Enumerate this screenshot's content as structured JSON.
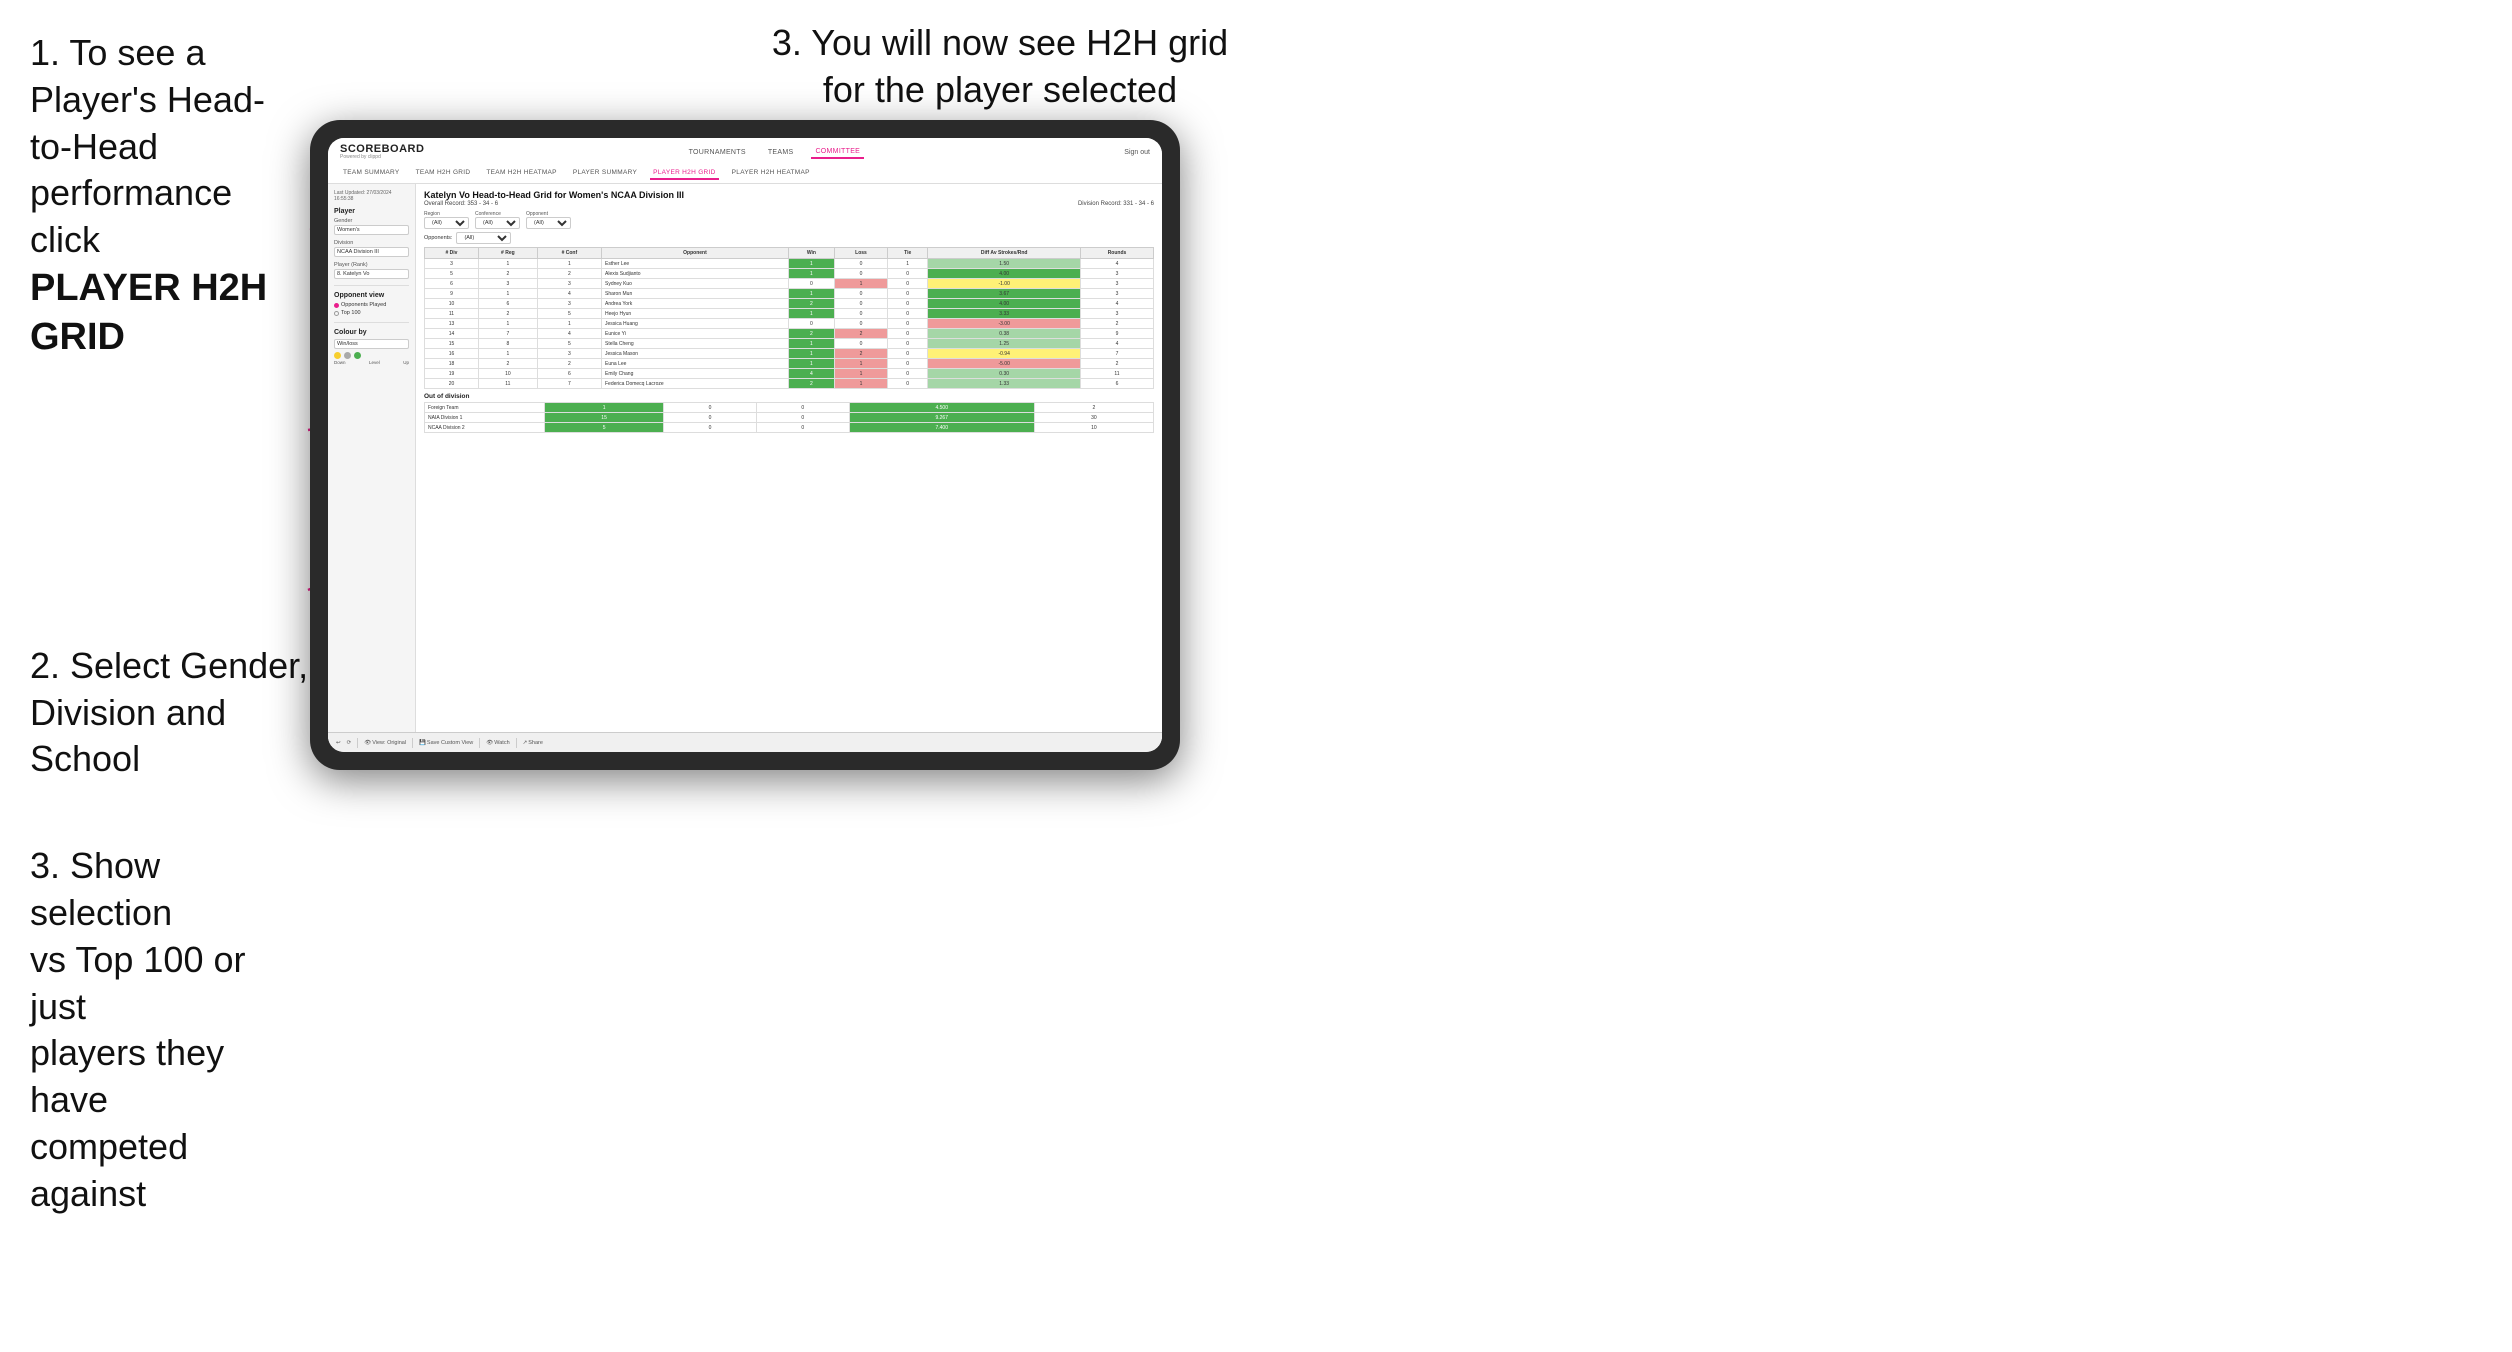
{
  "instructions": {
    "step1_line1": "1. To see a Player's Head-",
    "step1_line2": "to-Head performance click",
    "step1_bold": "PLAYER H2H GRID",
    "step2_line1": "2. Select Gender,",
    "step2_line2": "Division and",
    "step2_line3": "School",
    "step3a_line1": "3. Show selection",
    "step3a_line2": "vs Top 100 or just",
    "step3a_line3": "players they have",
    "step3a_line4": "competed against",
    "step3b_line1": "3. You will now see H2H grid",
    "step3b_line2": "for the player selected"
  },
  "navbar": {
    "logo_main": "SCOREBOARD",
    "logo_sub": "Powered by clippd",
    "nav_tournaments": "TOURNAMENTS",
    "nav_teams": "TEAMS",
    "nav_committee": "COMMITTEE",
    "sign_out": "Sign out",
    "sub_team_summary": "TEAM SUMMARY",
    "sub_team_h2h": "TEAM H2H GRID",
    "sub_team_heatmap": "TEAM H2H HEATMAP",
    "sub_player_summary": "PLAYER SUMMARY",
    "sub_player_h2h": "PLAYER H2H GRID",
    "sub_player_heatmap": "PLAYER H2H HEATMAP"
  },
  "left_panel": {
    "timestamp": "Last Updated: 27/03/2024",
    "timestamp2": "16:55:38",
    "player_label": "Player",
    "gender_label": "Gender",
    "gender_value": "Women's",
    "division_label": "Division",
    "division_value": "NCAA Division III",
    "player_rank_label": "Player (Rank)",
    "player_rank_value": "8. Katelyn Vo",
    "opponent_view_label": "Opponent view",
    "radio_opponents": "Opponents Played",
    "radio_top100": "Top 100",
    "colour_by_label": "Colour by",
    "colour_by_value": "Win/loss",
    "legend_down": "Down",
    "legend_level": "Level",
    "legend_up": "Up"
  },
  "grid": {
    "title": "Katelyn Vo Head-to-Head Grid for Women's NCAA Division III",
    "overall_record": "Overall Record: 353 - 34 - 6",
    "division_record": "Division Record: 331 - 34 - 6",
    "region_label": "Region",
    "conference_label": "Conference",
    "opponent_label": "Opponent",
    "opponents_label": "Opponents:",
    "all_option": "(All)",
    "col_div": "# Div",
    "col_reg": "# Reg",
    "col_conf": "# Conf",
    "col_opponent": "Opponent",
    "col_win": "Win",
    "col_loss": "Loss",
    "col_tie": "Tie",
    "col_diff": "Diff Av Strokes/Rnd",
    "col_rounds": "Rounds",
    "players": [
      {
        "div": 3,
        "reg": 1,
        "conf": 1,
        "name": "Esther Lee",
        "win": 1,
        "loss": 0,
        "tie": 1,
        "diff": 1.5,
        "rounds": 4,
        "win_color": "green_dark"
      },
      {
        "div": 5,
        "reg": 2,
        "conf": 2,
        "name": "Alexis Sudjianto",
        "win": 1,
        "loss": 0,
        "tie": 0,
        "diff": 4.0,
        "rounds": 3,
        "win_color": "green_dark"
      },
      {
        "div": 6,
        "reg": 3,
        "conf": 3,
        "name": "Sydney Kuo",
        "win": 0,
        "loss": 1,
        "tie": 0,
        "diff": -1.0,
        "rounds": 3,
        "win_color": "red_light"
      },
      {
        "div": 9,
        "reg": 1,
        "conf": 4,
        "name": "Sharon Mun",
        "win": 1,
        "loss": 0,
        "tie": 0,
        "diff": 3.67,
        "rounds": 3,
        "win_color": "green_dark"
      },
      {
        "div": 10,
        "reg": 6,
        "conf": 3,
        "name": "Andrea York",
        "win": 2,
        "loss": 0,
        "tie": 0,
        "diff": 4.0,
        "rounds": 4,
        "win_color": "green_dark"
      },
      {
        "div": 11,
        "reg": 2,
        "conf": 5,
        "name": "Heejo Hyun",
        "win": 1,
        "loss": 0,
        "tie": 0,
        "diff": 3.33,
        "rounds": 3,
        "win_color": "green_dark"
      },
      {
        "div": 13,
        "reg": 1,
        "conf": 1,
        "name": "Jessica Huang",
        "win": 0,
        "loss": 0,
        "tie": 0,
        "diff": -3.0,
        "rounds": 2,
        "win_color": "yellow"
      },
      {
        "div": 14,
        "reg": 7,
        "conf": 4,
        "name": "Eunice Yi",
        "win": 2,
        "loss": 2,
        "tie": 0,
        "diff": 0.38,
        "rounds": 9,
        "win_color": "yellow"
      },
      {
        "div": 15,
        "reg": 8,
        "conf": 5,
        "name": "Stella Cheng",
        "win": 1,
        "loss": 0,
        "tie": 0,
        "diff": 1.25,
        "rounds": 4,
        "win_color": "green_dark"
      },
      {
        "div": 16,
        "reg": 1,
        "conf": 3,
        "name": "Jessica Mason",
        "win": 1,
        "loss": 2,
        "tie": 0,
        "diff": -0.94,
        "rounds": 7,
        "win_color": "yellow"
      },
      {
        "div": 18,
        "reg": 2,
        "conf": 2,
        "name": "Euna Lee",
        "win": 1,
        "loss": 1,
        "tie": 0,
        "diff": -5.0,
        "rounds": 2,
        "win_color": "red_light"
      },
      {
        "div": 19,
        "reg": 10,
        "conf": 6,
        "name": "Emily Chang",
        "win": 4,
        "loss": 1,
        "tie": 0,
        "diff": 0.3,
        "rounds": 11,
        "win_color": "green_dark"
      },
      {
        "div": 20,
        "reg": 11,
        "conf": 7,
        "name": "Federica Domecq Lacroze",
        "win": 2,
        "loss": 1,
        "tie": 0,
        "diff": 1.33,
        "rounds": 6,
        "win_color": "green_light"
      }
    ],
    "out_of_division_label": "Out of division",
    "out_of_division": [
      {
        "name": "Foreign Team",
        "win": 1,
        "loss": 0,
        "tie": 0,
        "diff": 4.5,
        "rounds": 2
      },
      {
        "name": "NAIA Division 1",
        "win": 15,
        "loss": 0,
        "tie": 0,
        "diff": 9.267,
        "rounds": 30
      },
      {
        "name": "NCAA Division 2",
        "win": 5,
        "loss": 0,
        "tie": 0,
        "diff": 7.4,
        "rounds": 10
      }
    ]
  },
  "toolbar": {
    "undo": "↩",
    "redo": "↪",
    "view_original": "View: Original",
    "save_custom": "Save Custom View",
    "watch": "Watch",
    "share": "Share"
  }
}
